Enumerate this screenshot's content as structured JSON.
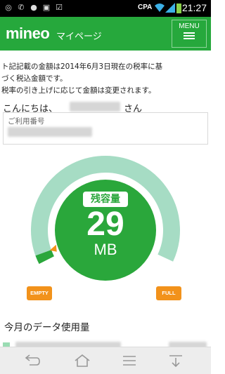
{
  "status_bar": {
    "carrier": "CPA",
    "time": "21:27",
    "left_icons": [
      "location-icon",
      "call-icon",
      "alarm-icon",
      "image-icon",
      "check-icon"
    ]
  },
  "header": {
    "logo": "mineo",
    "subtitle": "マイページ",
    "menu_label": "MENU"
  },
  "notice": {
    "lines": [
      "ト記記載の金額は2014年6月3日現在の税率に基",
      "づく税込金額です。",
      "税率の引き上げに応じて金額は変更されます。"
    ]
  },
  "greeting": {
    "hello": "こんにちは、",
    "suffix": "さん"
  },
  "contract": {
    "caption": "ご利用番号"
  },
  "gauge": {
    "remaining_label": "残容量",
    "remaining_value": "29",
    "unit": "MB",
    "empty_label": "EMPTY",
    "full_label": "FULL",
    "fill_fraction": 0.03,
    "color_ring": "#a6dcc4",
    "color_fill": "#2aa73b",
    "color_marker": "#f2921b"
  },
  "usage": {
    "title": "今月のデータ使用量"
  },
  "colors": {
    "brand_green": "#26a83c",
    "accent_orange": "#f2921b"
  },
  "navbar": {
    "icons": [
      "back-icon",
      "home-icon",
      "menu-icon",
      "collapse-icon"
    ]
  }
}
